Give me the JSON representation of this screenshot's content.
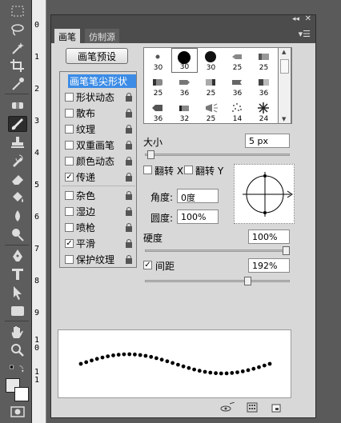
{
  "panel": {
    "tabs": [
      {
        "label": "画笔"
      },
      {
        "label": "仿制源"
      }
    ],
    "preset_button": "画笔预设",
    "options": [
      {
        "label": "画笔笔尖形状",
        "checked": null,
        "active": true
      },
      {
        "label": "形状动态",
        "checked": false
      },
      {
        "label": "散布",
        "checked": false
      },
      {
        "label": "纹理",
        "checked": false
      },
      {
        "label": "双重画笔",
        "checked": false
      },
      {
        "label": "颜色动态",
        "checked": false
      },
      {
        "label": "传递",
        "checked": true
      },
      {
        "label": "杂色",
        "checked": false
      },
      {
        "label": "湿边",
        "checked": false
      },
      {
        "label": "喷枪",
        "checked": false
      },
      {
        "label": "平滑",
        "checked": true
      },
      {
        "label": "保护纹理",
        "checked": false
      }
    ],
    "brush_tips": [
      {
        "size": "30"
      },
      {
        "size": "30"
      },
      {
        "size": "30"
      },
      {
        "size": "25"
      },
      {
        "size": "25"
      },
      {
        "size": "25"
      },
      {
        "size": "36"
      },
      {
        "size": "25"
      },
      {
        "size": "36"
      },
      {
        "size": "36"
      },
      {
        "size": "36"
      },
      {
        "size": "32"
      },
      {
        "size": "25"
      },
      {
        "size": "14"
      },
      {
        "size": "24"
      }
    ],
    "size_label": "大小",
    "size_value": "5 px",
    "flip_x_label": "翻转 X",
    "flip_y_label": "翻转 Y",
    "angle_label": "角度:",
    "angle_value": "0度",
    "roundness_label": "圆度:",
    "roundness_value": "100%",
    "hardness_label": "硬度",
    "hardness_value": "100%",
    "spacing_label": "间距",
    "spacing_value": "192%",
    "spacing_checked": true,
    "size_level": 0.02,
    "hardness_level": 1.0,
    "spacing_level": 0.72
  },
  "ruler": {
    "labels": [
      "0",
      "1",
      "2",
      "3",
      "4",
      "5",
      "6",
      "7",
      "8",
      "9",
      "1",
      "0",
      "1",
      "1"
    ]
  },
  "colors": {
    "highlight": "#3c8ce6",
    "panel_bg": "#d8d8d8",
    "toolbar_bg": "#5d5d5d"
  }
}
